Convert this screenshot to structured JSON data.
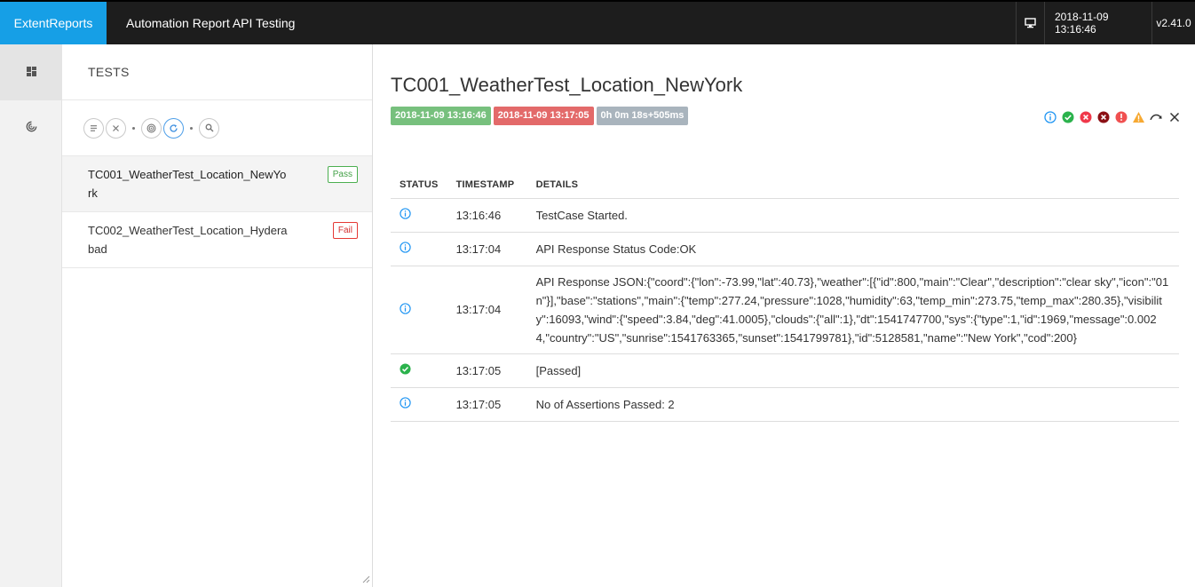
{
  "brand": "ExtentReports",
  "report_name": "Automation Report API Testing",
  "top_right": {
    "date": "2018-11-09 13:16:46",
    "version": "v2.41.0",
    "monitor_icon": "monitor-icon"
  },
  "rail": [
    {
      "icon": "dashboard-icon"
    },
    {
      "icon": "tests-radar-icon"
    }
  ],
  "tests_panel": {
    "heading": "TESTS",
    "tools": [
      "filter-list-icon",
      "clear-icon",
      "radar-icon",
      "refresh-icon",
      "search-icon"
    ],
    "items": [
      {
        "name": "TC001_WeatherTest_Location_NewYork",
        "status": "Pass"
      },
      {
        "name": "TC002_WeatherTest_Location_Hyderabad",
        "status": "Fail"
      }
    ]
  },
  "detail": {
    "title": "TC001_WeatherTest_Location_NewYork",
    "start": "2018-11-09 13:16:46",
    "end": "2018-11-09 13:17:05",
    "duration": "0h 0m 18s+505ms",
    "headers": {
      "status": "STATUS",
      "timestamp": "TIMESTAMP",
      "details": "DETAILS"
    },
    "logs": [
      {
        "status": "info",
        "time": "13:16:46",
        "details": "TestCase Started."
      },
      {
        "status": "info",
        "time": "13:17:04",
        "details": "API Response Status Code:OK"
      },
      {
        "status": "info",
        "time": "13:17:04",
        "details": "API Response JSON:{\"coord\":{\"lon\":-73.99,\"lat\":40.73},\"weather\":[{\"id\":800,\"main\":\"Clear\",\"description\":\"clear sky\",\"icon\":\"01n\"}],\"base\":\"stations\",\"main\":{\"temp\":277.24,\"pressure\":1028,\"humidity\":63,\"temp_min\":273.75,\"temp_max\":280.35},\"visibility\":16093,\"wind\":{\"speed\":3.84,\"deg\":41.0005},\"clouds\":{\"all\":1},\"dt\":1541747700,\"sys\":{\"type\":1,\"id\":1969,\"message\":0.0024,\"country\":\"US\",\"sunrise\":1541763365,\"sunset\":1541799781},\"id\":5128581,\"name\":\"New York\",\"cod\":200}"
      },
      {
        "status": "pass",
        "time": "13:17:05",
        "details": "[Passed]"
      },
      {
        "status": "info",
        "time": "13:17:05",
        "details": "No of Assertions Passed: 2"
      }
    ]
  },
  "colors": {
    "brand": "#169fe6",
    "pass": "#4caf50",
    "fail": "#e53935",
    "info": "#2196f3"
  }
}
